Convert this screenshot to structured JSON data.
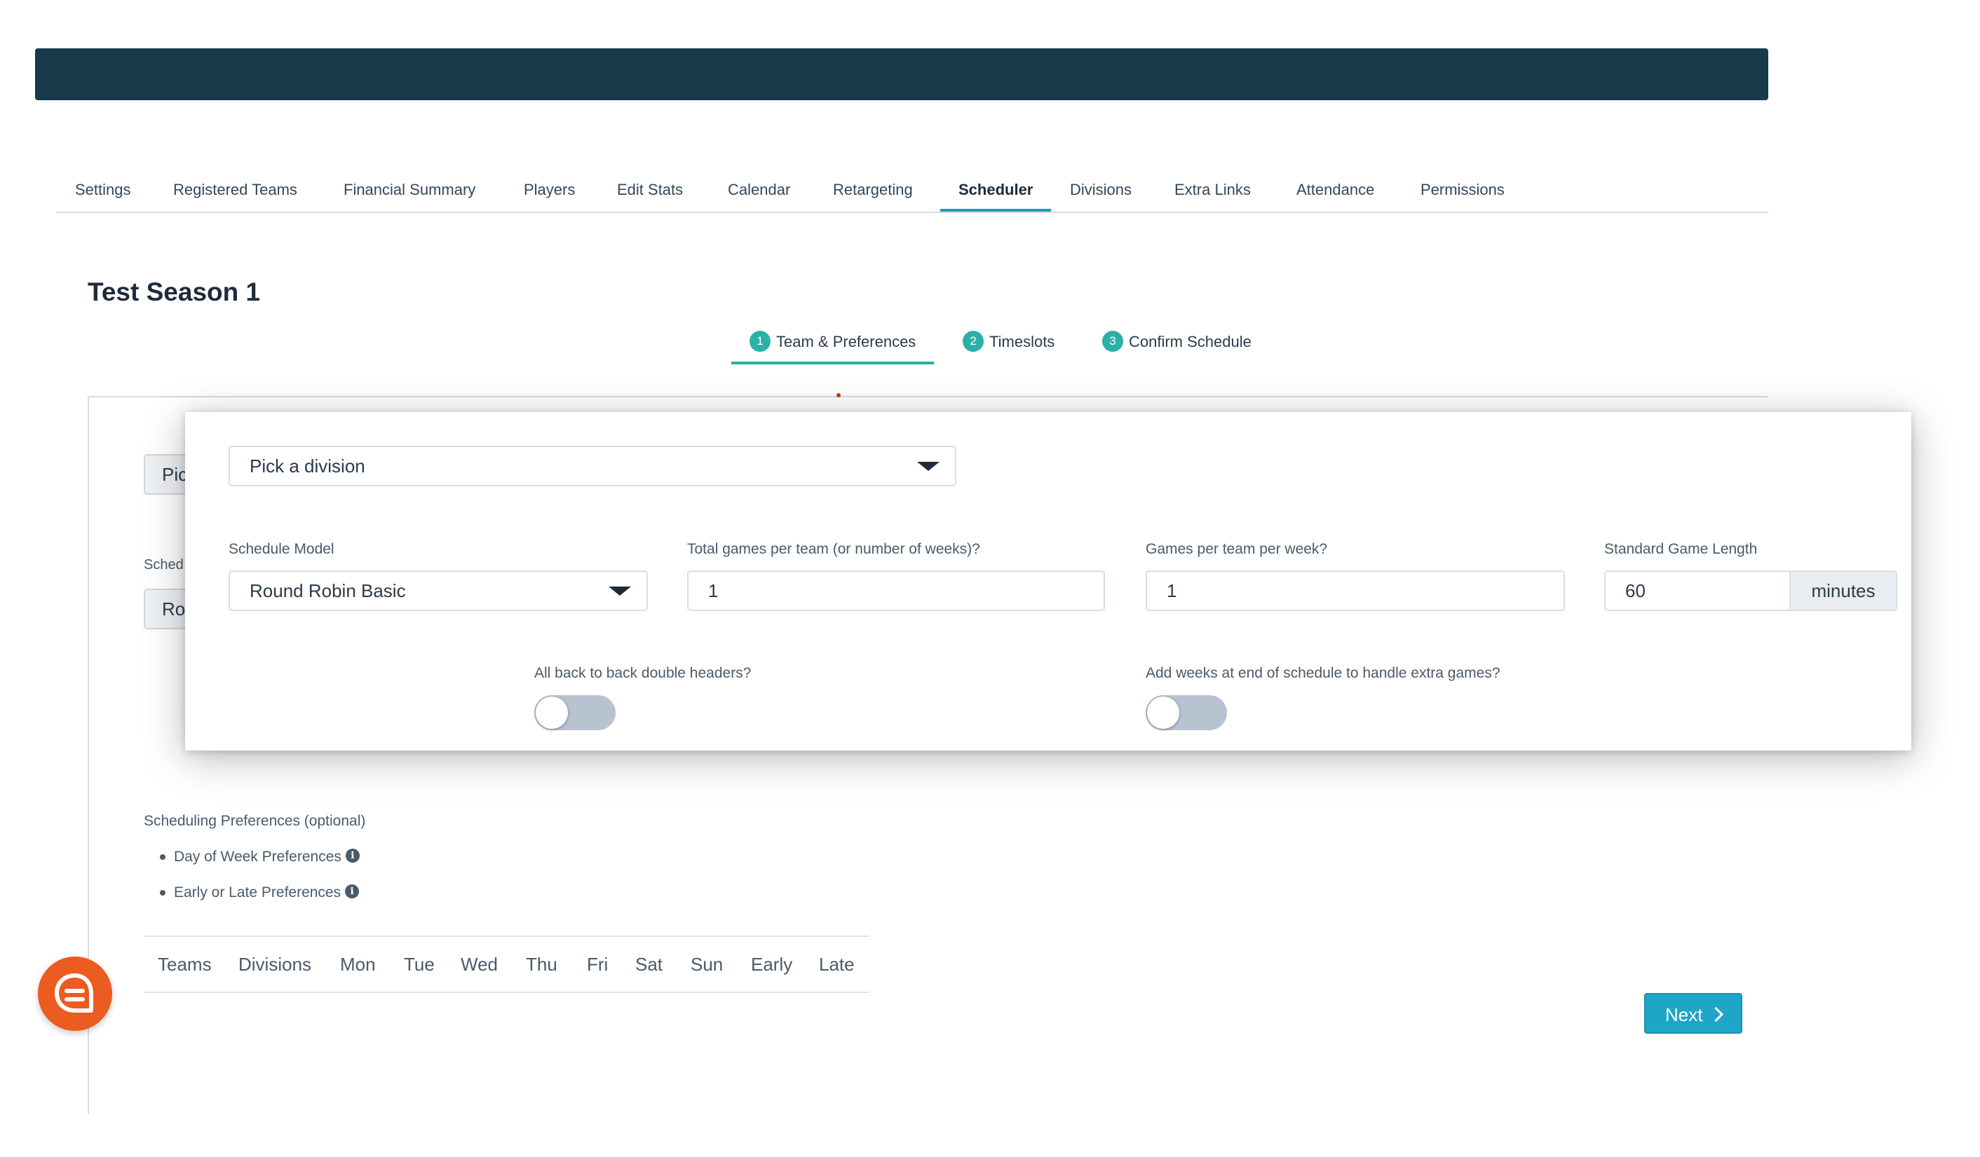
{
  "main_tabs": [
    {
      "label": "Settings"
    },
    {
      "label": "Registered Teams"
    },
    {
      "label": "Financial Summary"
    },
    {
      "label": "Players"
    },
    {
      "label": "Edit Stats"
    },
    {
      "label": "Calendar"
    },
    {
      "label": "Retargeting"
    },
    {
      "label": "Scheduler"
    },
    {
      "label": "Divisions"
    },
    {
      "label": "Extra Links"
    },
    {
      "label": "Attendance"
    },
    {
      "label": "Permissions"
    }
  ],
  "active_main_tab": "Scheduler",
  "page_title": "Test Season 1",
  "steps": [
    {
      "num": "1",
      "label": "Team & Preferences"
    },
    {
      "num": "2",
      "label": "Timeslots"
    },
    {
      "num": "3",
      "label": "Confirm Schedule"
    }
  ],
  "background_peek": {
    "division_partial": "Pic",
    "schedule_label_partial": "Sched",
    "schedule_value_partial": "Ro"
  },
  "card": {
    "division_select": "Pick a division",
    "schedule_model_label": "Schedule Model",
    "schedule_model_value": "Round Robin Basic",
    "total_games_label": "Total games per team (or number of weeks)?",
    "total_games_value": "1",
    "games_per_week_label": "Games per team per week?",
    "games_per_week_value": "1",
    "game_length_label": "Standard Game Length",
    "game_length_value": "60",
    "game_length_unit": "minutes",
    "double_headers_label": "All back to back double headers?",
    "double_headers_on": false,
    "add_weeks_label": "Add weeks at end of schedule to handle extra games?",
    "add_weeks_on": false
  },
  "preferences": {
    "title": "Scheduling Preferences (optional)",
    "items": [
      "Day of Week Preferences",
      "Early or Late Preferences"
    ],
    "table_headers": [
      "Teams",
      "Divisions",
      "Mon",
      "Tue",
      "Wed",
      "Thu",
      "Fri",
      "Sat",
      "Sun",
      "Early",
      "Late"
    ]
  },
  "next_button": "Next",
  "colors": {
    "topbar": "#173a4a",
    "accent_teal": "#2bb0a7",
    "tab_underline": "#1f9eb3",
    "next_button": "#1fa5c8",
    "chat_fab": "#ec5b1f"
  }
}
